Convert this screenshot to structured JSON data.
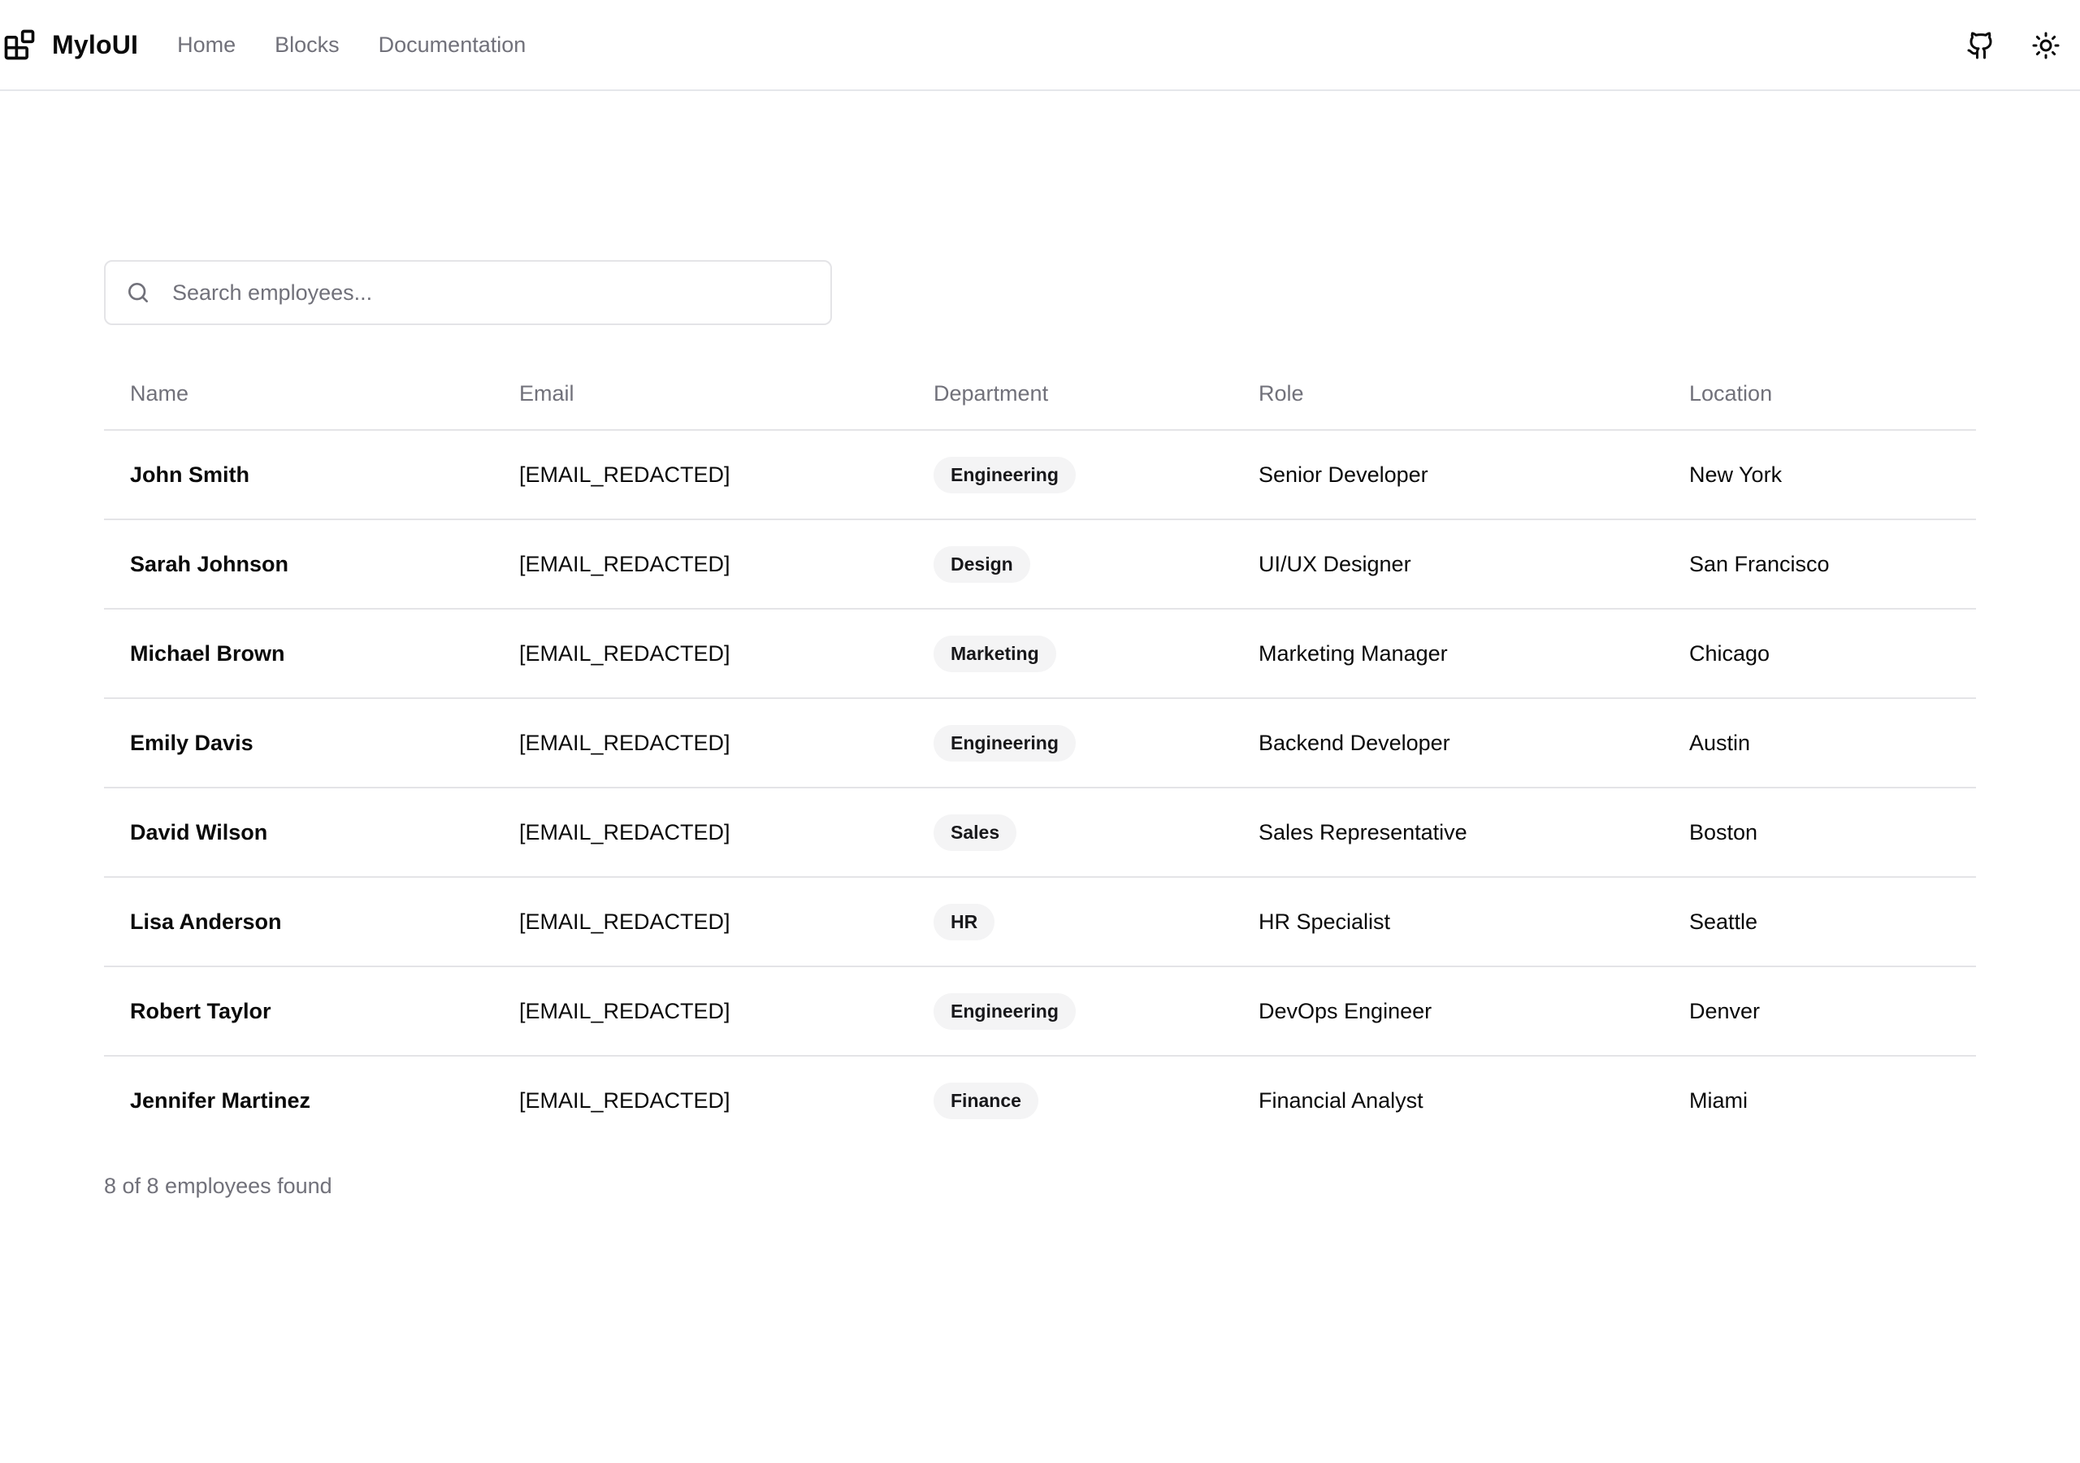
{
  "header": {
    "brand": "MyloUI",
    "nav": [
      "Home",
      "Blocks",
      "Documentation"
    ],
    "icons": [
      "github-icon",
      "sun-icon"
    ]
  },
  "search": {
    "placeholder": "Search employees...",
    "value": ""
  },
  "table": {
    "columns": [
      "Name",
      "Email",
      "Department",
      "Role",
      "Location"
    ],
    "rows": [
      {
        "name": "John Smith",
        "email": "[EMAIL_REDACTED]",
        "department": "Engineering",
        "role": "Senior Developer",
        "location": "New York"
      },
      {
        "name": "Sarah Johnson",
        "email": "[EMAIL_REDACTED]",
        "department": "Design",
        "role": "UI/UX Designer",
        "location": "San Francisco"
      },
      {
        "name": "Michael Brown",
        "email": "[EMAIL_REDACTED]",
        "department": "Marketing",
        "role": "Marketing Manager",
        "location": "Chicago"
      },
      {
        "name": "Emily Davis",
        "email": "[EMAIL_REDACTED]",
        "department": "Engineering",
        "role": "Backend Developer",
        "location": "Austin"
      },
      {
        "name": "David Wilson",
        "email": "[EMAIL_REDACTED]",
        "department": "Sales",
        "role": "Sales Representative",
        "location": "Boston"
      },
      {
        "name": "Lisa Anderson",
        "email": "[EMAIL_REDACTED]",
        "department": "HR",
        "role": "HR Specialist",
        "location": "Seattle"
      },
      {
        "name": "Robert Taylor",
        "email": "[EMAIL_REDACTED]",
        "department": "Engineering",
        "role": "DevOps Engineer",
        "location": "Denver"
      },
      {
        "name": "Jennifer Martinez",
        "email": "[EMAIL_REDACTED]",
        "department": "Finance",
        "role": "Financial Analyst",
        "location": "Miami"
      }
    ]
  },
  "footer": {
    "count_text": "8 of 8 employees found"
  },
  "colors": {
    "muted_text": "#71717a",
    "border": "#e4e4e7",
    "badge_bg": "#f4f4f5",
    "text": "#0a0a0a"
  }
}
